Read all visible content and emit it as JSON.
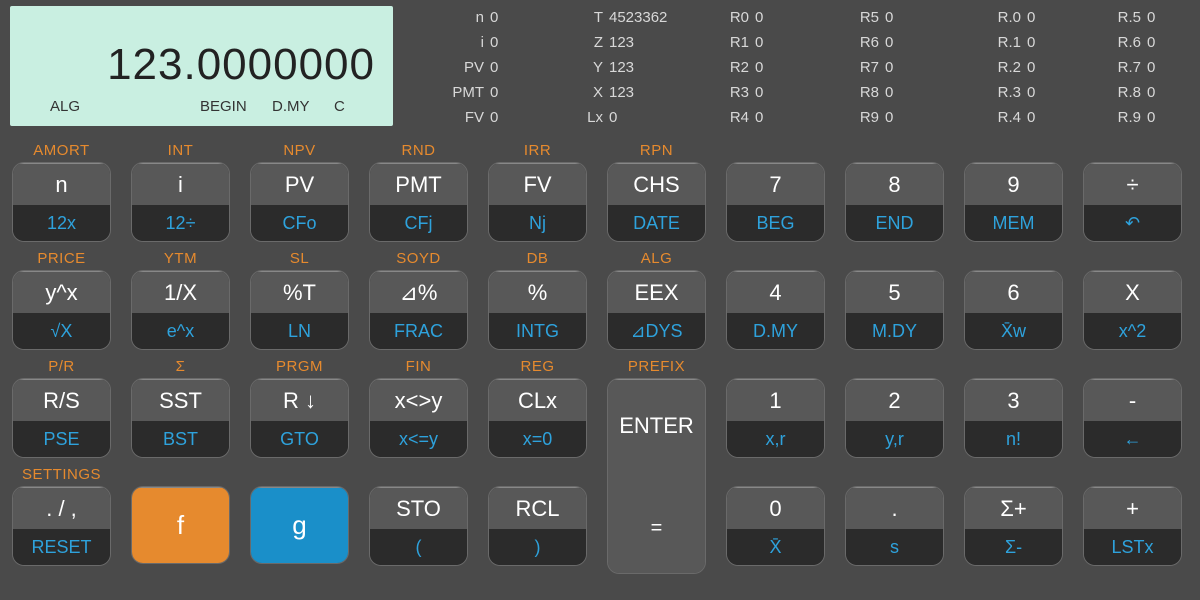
{
  "display": {
    "value": "123.0000000",
    "annunciators": {
      "alg": "ALG",
      "begin": "BEGIN",
      "dmy": "D.MY",
      "c": "C"
    }
  },
  "regs_fin": [
    {
      "l": "n",
      "v": "0"
    },
    {
      "l": "i",
      "v": "0"
    },
    {
      "l": "PV",
      "v": "0"
    },
    {
      "l": "PMT",
      "v": "0"
    },
    {
      "l": "FV",
      "v": "0"
    }
  ],
  "regs_stack": [
    {
      "l": "T",
      "v": "4523362"
    },
    {
      "l": "Z",
      "v": "123"
    },
    {
      "l": "Y",
      "v": "123"
    },
    {
      "l": "X",
      "v": "123"
    },
    {
      "l": "Lx",
      "v": "0"
    }
  ],
  "regs_r0": [
    {
      "l": "R0",
      "v": "0"
    },
    {
      "l": "R1",
      "v": "0"
    },
    {
      "l": "R2",
      "v": "0"
    },
    {
      "l": "R3",
      "v": "0"
    },
    {
      "l": "R4",
      "v": "0"
    }
  ],
  "regs_r5": [
    {
      "l": "R5",
      "v": "0"
    },
    {
      "l": "R6",
      "v": "0"
    },
    {
      "l": "R7",
      "v": "0"
    },
    {
      "l": "R8",
      "v": "0"
    },
    {
      "l": "R9",
      "v": "0"
    }
  ],
  "regs_rd0": [
    {
      "l": "R.0",
      "v": "0"
    },
    {
      "l": "R.1",
      "v": "0"
    },
    {
      "l": "R.2",
      "v": "0"
    },
    {
      "l": "R.3",
      "v": "0"
    },
    {
      "l": "R.4",
      "v": "0"
    }
  ],
  "regs_rd5": [
    {
      "l": "R.5",
      "v": "0"
    },
    {
      "l": "R.6",
      "v": "0"
    },
    {
      "l": "R.7",
      "v": "0"
    },
    {
      "l": "R.8",
      "v": "0"
    },
    {
      "l": "R.9",
      "v": "0"
    }
  ],
  "rows": [
    [
      {
        "f": "AMORT",
        "t": "n",
        "b": "12x"
      },
      {
        "f": "INT",
        "t": "i",
        "b": "12÷"
      },
      {
        "f": "NPV",
        "t": "PV",
        "b": "CFo"
      },
      {
        "f": "RND",
        "t": "PMT",
        "b": "CFj"
      },
      {
        "f": "IRR",
        "t": "FV",
        "b": "Nj"
      },
      {
        "f": "RPN",
        "t": "CHS",
        "b": "DATE"
      },
      {
        "f": "",
        "t": "7",
        "b": "BEG"
      },
      {
        "f": "",
        "t": "8",
        "b": "END"
      },
      {
        "f": "",
        "t": "9",
        "b": "MEM"
      },
      {
        "f": "",
        "t": "÷",
        "b": "↶"
      }
    ],
    [
      {
        "f": "PRICE",
        "t": "y^x",
        "b": "√X"
      },
      {
        "f": "YTM",
        "t": "1/X",
        "b": "e^x"
      },
      {
        "f": "SL",
        "t": "%T",
        "b": "LN"
      },
      {
        "f": "SOYD",
        "t": "⊿%",
        "b": "FRAC"
      },
      {
        "f": "DB",
        "t": "%",
        "b": "INTG"
      },
      {
        "f": "ALG",
        "t": "EEX",
        "b": "⊿DYS"
      },
      {
        "f": "",
        "t": "4",
        "b": "D.MY"
      },
      {
        "f": "",
        "t": "5",
        "b": "M.DY"
      },
      {
        "f": "",
        "t": "6",
        "b": "X̄w"
      },
      {
        "f": "",
        "t": "X",
        "b": "x^2"
      }
    ],
    [
      {
        "f": "P/R",
        "t": "R/S",
        "b": "PSE"
      },
      {
        "f": "Σ",
        "t": "SST",
        "b": "BST"
      },
      {
        "f": "PRGM",
        "t": "R ↓",
        "b": "GTO"
      },
      {
        "f": "FIN",
        "t": "x<>y",
        "b": "x<=y"
      },
      {
        "f": "REG",
        "t": "CLx",
        "b": "x=0"
      },
      {
        "f": "PREFIX",
        "t": "ENTER",
        "b": "=",
        "enter": true
      },
      {
        "f": "",
        "t": "1",
        "b": "x,r"
      },
      {
        "f": "",
        "t": "2",
        "b": "y,r"
      },
      {
        "f": "",
        "t": "3",
        "b": "n!"
      },
      {
        "f": "",
        "t": "-",
        "b": "←"
      }
    ],
    [
      {
        "f": "SETTINGS",
        "t": ". / ,",
        "b": "RESET"
      },
      {
        "f": "",
        "t": "f",
        "b": "",
        "fkey": true
      },
      {
        "f": "",
        "t": "g",
        "b": "",
        "gkey": true
      },
      {
        "f": "",
        "t": "STO",
        "b": "("
      },
      {
        "f": "",
        "t": "RCL",
        "b": ")"
      },
      {
        "f": "",
        "skip": true
      },
      {
        "f": "",
        "t": "0",
        "b": "X̄"
      },
      {
        "f": "",
        "t": ".",
        "b": "s"
      },
      {
        "f": "",
        "t": "Σ+",
        "b": "Σ-"
      },
      {
        "f": "",
        "t": "+",
        "b": "LSTx"
      }
    ]
  ]
}
